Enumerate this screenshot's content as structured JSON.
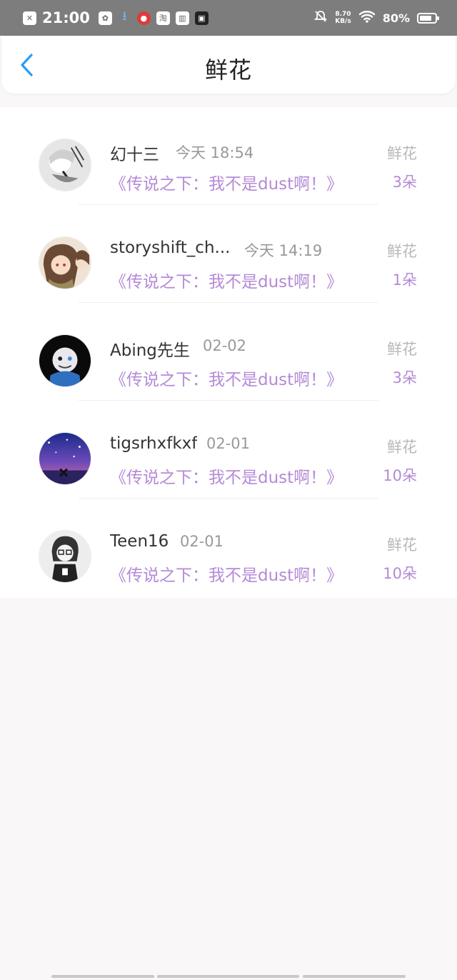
{
  "status_bar": {
    "time": "21:00",
    "network_speed_value": "8.70",
    "network_speed_unit": "KB/s",
    "battery": "80%",
    "battery_level": 0.8,
    "icons": [
      "sim-icon",
      "paw-icon",
      "download-icon",
      "app-icon",
      "taobao-icon",
      "book-icon",
      "tv-icon",
      "mute-icon",
      "wifi-icon",
      "battery-icon"
    ]
  },
  "header": {
    "title": "鲜花",
    "back_icon": "chevron-left-icon",
    "accent": "#2a9df4"
  },
  "colors": {
    "purple": "#b48ad6",
    "muted": "#999999"
  },
  "items": [
    {
      "name": "幻十三",
      "time": "今天 18:54",
      "book": "《传说之下：我不是dust啊！》",
      "gift_label": "鲜花",
      "count": "3朵"
    },
    {
      "name": "storyshift_ch...",
      "time": "今天 14:19",
      "book": "《传说之下：我不是dust啊！》",
      "gift_label": "鲜花",
      "count": "1朵"
    },
    {
      "name": "Abing先生",
      "time": "02-02",
      "book": "《传说之下：我不是dust啊！》",
      "gift_label": "鲜花",
      "count": "3朵"
    },
    {
      "name": "tigsrhxfkxf",
      "time": "02-01",
      "book": "《传说之下：我不是dust啊！》",
      "gift_label": "鲜花",
      "count": "10朵"
    },
    {
      "name": "Teen16",
      "time": "02-01",
      "book": "《传说之下：我不是dust啊！》",
      "gift_label": "鲜花",
      "count": "10朵"
    }
  ]
}
